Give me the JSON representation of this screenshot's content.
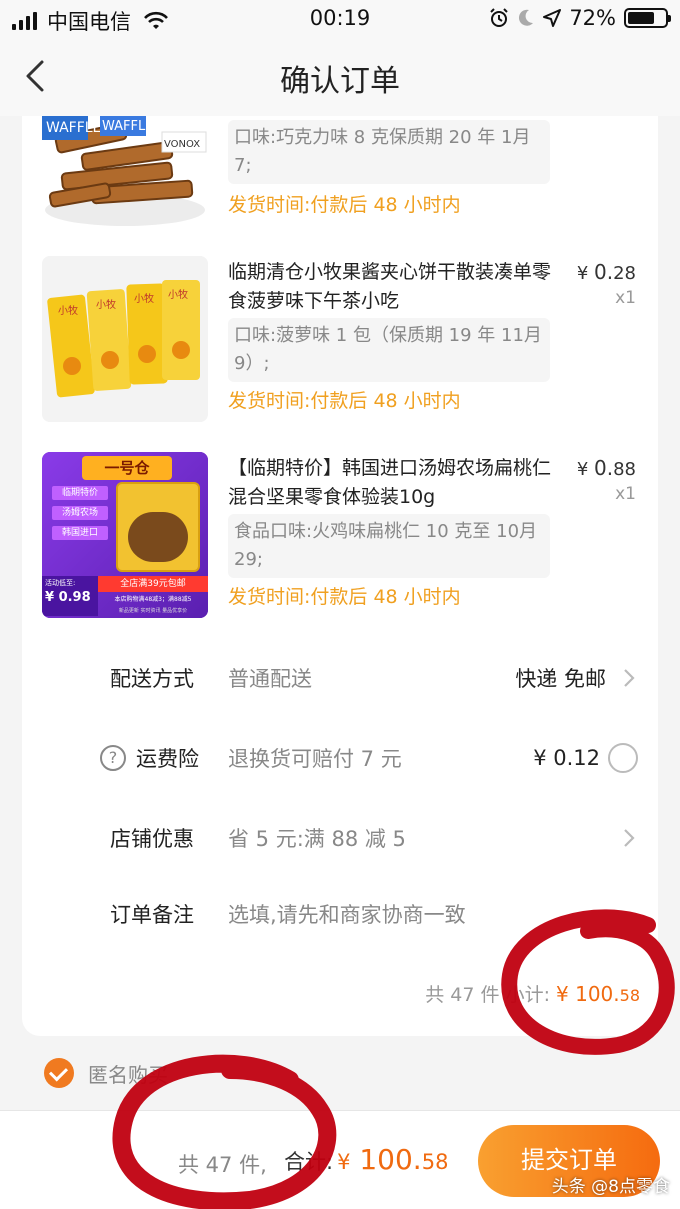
{
  "status_bar": {
    "carrier": "中国电信",
    "time": "00:19",
    "battery_text": "72%",
    "battery_level": 0.72
  },
  "nav": {
    "title": "确认订单"
  },
  "products": [
    {
      "sku": "口味:巧克力味 8 克保质期 20 年 1月7;",
      "shipping": "发货时间:付款后 48 小时内",
      "image_text": [
        "WAFFLE",
        "WAFFLE",
        "VONOX"
      ]
    },
    {
      "title": "临期清仓小牧果酱夹心饼干散装凑单零食菠萝味下午茶小吃",
      "price_symbol": "¥",
      "price_int": "0.",
      "price_dec": "28",
      "qty": "x1",
      "sku": "口味:菠萝味 1 包（保质期 19 年 11月9）;",
      "shipping": "发货时间:付款后 48 小时内",
      "image_text": "小牧"
    },
    {
      "title": "【临期特价】韩国进口汤姆农场扁桃仁混合坚果零食体验装10g",
      "price_symbol": "¥",
      "price_int": "0.",
      "price_dec": "88",
      "qty": "x1",
      "sku": "食品口味:火鸡味扁桃仁 10 克至 10月29;",
      "shipping": "发货时间:付款后 48 小时内",
      "image": {
        "store": "一号仓",
        "tags": [
          "临期特价",
          "汤姆农场",
          "韩国进口"
        ],
        "promo_label": "活动低至:",
        "promo_price": "¥ 0.98",
        "promo_banner": "全店满39元包邮",
        "promo_sub": "本店购物满48减3；满88减5",
        "fine_print": "新品更新 实时资讯 量品优享价"
      }
    }
  ],
  "options": {
    "delivery": {
      "label": "配送方式",
      "value": "普通配送",
      "right": "快递 免邮"
    },
    "insurance": {
      "icon_text": "?",
      "label": "运费险",
      "value": "退换货可赔付 7 元",
      "right": "¥ 0.12"
    },
    "discount": {
      "label": "店铺优惠",
      "value": "省 5 元:满 88 减 5"
    },
    "note": {
      "label": "订单备注",
      "placeholder": "选填,请先和商家协商一致"
    }
  },
  "subtotal": {
    "count_text": "共 47 件",
    "label": "小计:",
    "symbol": "¥",
    "int": "100.",
    "dec": "58"
  },
  "anonymous": {
    "label": "匿名购买",
    "checked": true
  },
  "bottom_bar": {
    "count_text": "共 47 件,",
    "total_label": "合计:",
    "symbol": "¥",
    "int": "100.",
    "dec": "58",
    "submit_label": "提交订单"
  },
  "watermark": "头条 @8点零食",
  "colors": {
    "accent": "#f06a10",
    "ship_text": "#f0a020",
    "button_start": "#f9a030",
    "button_end": "#f56b0f",
    "annotation_red": "#c00010"
  }
}
